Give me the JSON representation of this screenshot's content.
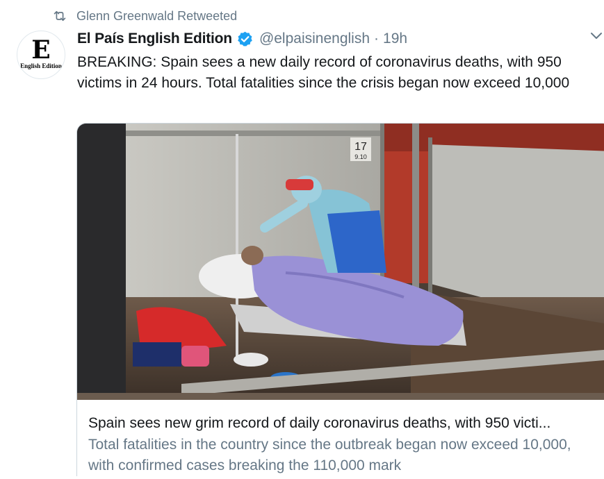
{
  "retweet": {
    "icon": "retweet-icon",
    "text": "Glenn Greenwald Retweeted"
  },
  "author": {
    "avatar_icon": "el-pais-logo",
    "avatar_letter": "E",
    "avatar_sub": "English Edition",
    "name": "El País English Edition",
    "verified_icon": "verified-badge-icon",
    "handle": "@elpaisinenglish",
    "separator": "·",
    "time": "19h"
  },
  "menu_icon": "chevron-down-icon",
  "tweet": {
    "text": "BREAKING: Spain sees a new daily record of coronavirus deaths, with 950 victims in 24 hours. Total fatalities since the crisis began now exceed 10,000"
  },
  "card": {
    "image_number": "17",
    "image_subnumber": "9.10",
    "title": "Spain sees new grim record of daily coronavirus deaths, with 950 victi...",
    "description": "Total fatalities in the country since the outbreak began now exceed 10,000, with confirmed cases breaking the 110,000 mark"
  },
  "colors": {
    "text_primary": "#14171a",
    "text_secondary": "#657786",
    "verified_blue": "#1da1f2",
    "border": "#ccd6dd"
  }
}
